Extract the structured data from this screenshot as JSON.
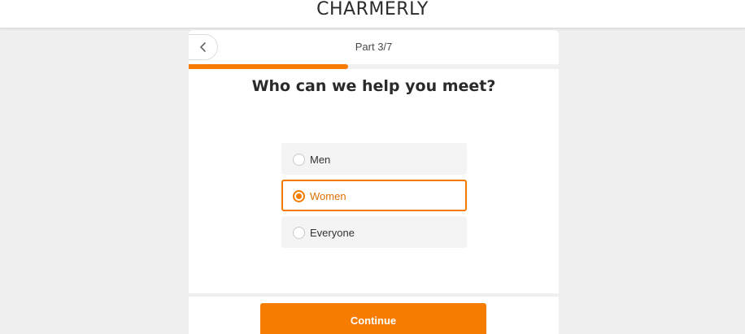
{
  "brand": {
    "logo_text": "CHARMERLY"
  },
  "header": {
    "part_label": "Part 3/7",
    "back_icon": "chevron-left-icon"
  },
  "progress": {
    "fraction": 0.43,
    "color": "#f57c00"
  },
  "question": {
    "title": "Who can we help you meet?"
  },
  "options": [
    {
      "label": "Men",
      "selected": false
    },
    {
      "label": "Women",
      "selected": true
    },
    {
      "label": "Everyone",
      "selected": false
    }
  ],
  "footer": {
    "continue_label": "Continue"
  },
  "colors": {
    "accent": "#f57c00",
    "background": "#efefef",
    "card": "#ffffff",
    "option_bg": "#f4f4f4"
  }
}
